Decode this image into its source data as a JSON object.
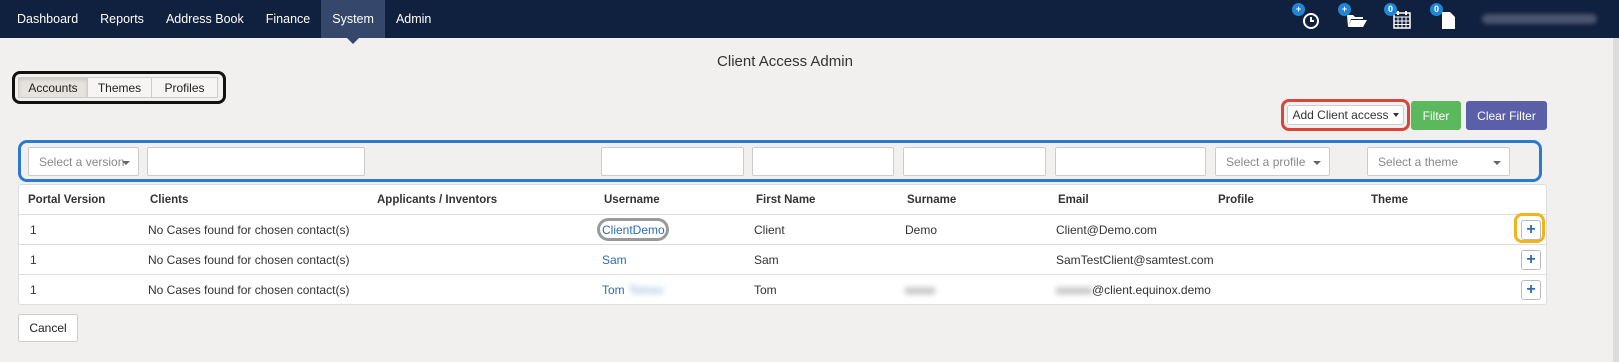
{
  "nav": {
    "items": [
      "Dashboard",
      "Reports",
      "Address Book",
      "Finance",
      "System",
      "Admin"
    ],
    "active": "System",
    "badges": {
      "timer": "+",
      "folder": "+",
      "calendar": "0",
      "docs": "0"
    }
  },
  "page": {
    "title": "Client Access Admin"
  },
  "tabs": [
    "Accounts",
    "Themes",
    "Profiles"
  ],
  "toolbar": {
    "add_label": "Add Client access",
    "filter_label": "Filter",
    "clear_label": "Clear Filter"
  },
  "filters": {
    "version_placeholder": "Select a version",
    "profile_placeholder": "Select a profile",
    "theme_placeholder": "Select a theme"
  },
  "table": {
    "headers": [
      "Portal Version",
      "Clients",
      "Applicants / Inventors",
      "Username",
      "First Name",
      "Surname",
      "Email",
      "Profile",
      "Theme"
    ],
    "rows": [
      {
        "version": "1",
        "clients": "No Cases found for chosen contact(s)",
        "username": "ClientDemo",
        "first": "Client",
        "surname": "Demo",
        "email": "Client@Demo.com"
      },
      {
        "version": "1",
        "clients": "No Cases found for chosen contact(s)",
        "username": "Sam",
        "first": "Sam",
        "surname": "",
        "email": "SamTestClient@samtest.com"
      },
      {
        "version": "1",
        "clients": "No Cases found for chosen contact(s)",
        "username": "Tom",
        "first": "Tom",
        "surname": "",
        "email": "@client.equinox.demo"
      }
    ],
    "add_symbol": "+"
  },
  "footer": {
    "cancel_label": "Cancel"
  },
  "colors": {
    "navbar": "#10203f",
    "filter_green": "#5cb85c",
    "clear_purple": "#5a5fa8",
    "link": "#2a6eb5"
  }
}
